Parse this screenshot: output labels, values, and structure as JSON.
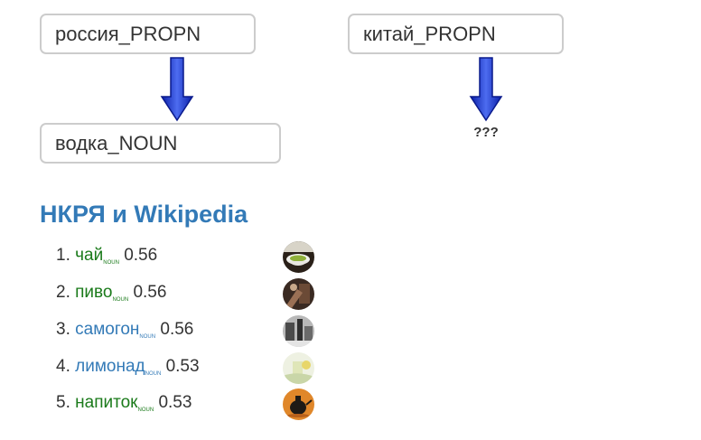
{
  "query": {
    "source_word": "россия_PROPN",
    "source_result": "водка_NOUN",
    "target_word": "китай_PROPN",
    "target_result": "???"
  },
  "section": {
    "title": "НКРЯ и Wikipedia"
  },
  "results": [
    {
      "rank": "1.",
      "word": "чай",
      "pos": "NOUN",
      "score": "0.56",
      "word_color": "green",
      "thumbnail_icon": "tea-cup-photo"
    },
    {
      "rank": "2.",
      "word": "пиво",
      "pos": "NOUN",
      "score": "0.56",
      "word_color": "green",
      "thumbnail_icon": "beer-photo"
    },
    {
      "rank": "3.",
      "word": "самогон",
      "pos": "NOUN",
      "score": "0.56",
      "word_color": "blue",
      "thumbnail_icon": "moonshine-still-photo"
    },
    {
      "rank": "4.",
      "word": "лимонад",
      "pos": "NOUN",
      "score": "0.53",
      "word_color": "blue",
      "thumbnail_icon": "lemonade-photo"
    },
    {
      "rank": "5.",
      "word": "напиток",
      "pos": "NOUN",
      "score": "0.53",
      "word_color": "green",
      "thumbnail_icon": "drink-kettle-photo"
    }
  ],
  "colors": {
    "title_blue": "#337ab7",
    "link_green": "#1a7a1a",
    "link_blue": "#337ab7",
    "arrow_blue": "#0a22c8",
    "box_border": "#cccccc"
  }
}
